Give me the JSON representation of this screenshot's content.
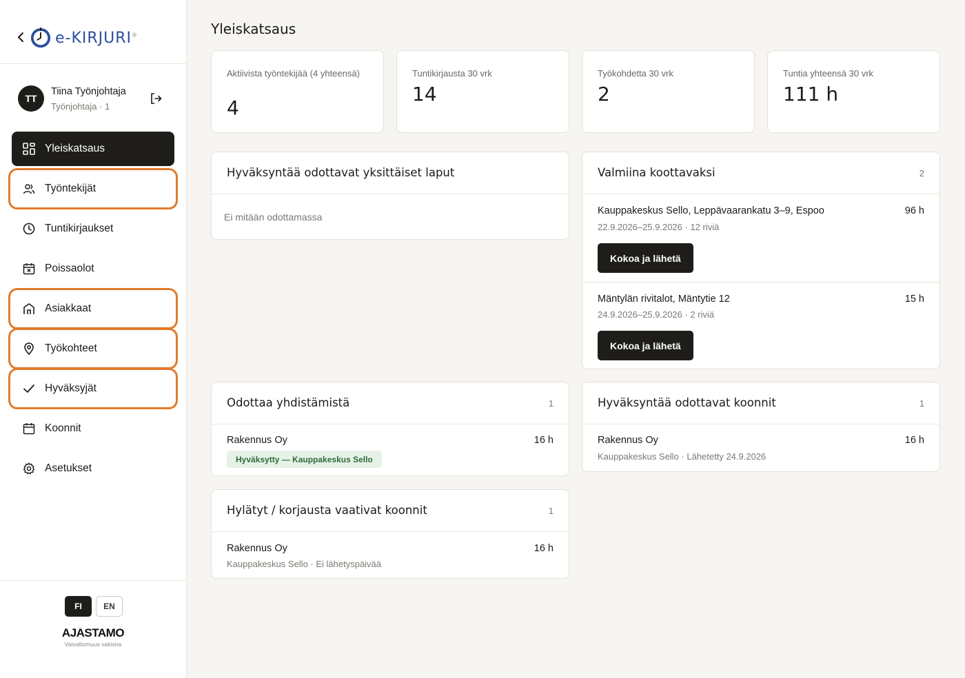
{
  "brand": {
    "logo_text": "e-KIRJURI",
    "logo_mark": "®"
  },
  "user": {
    "initials": "TT",
    "name": "Tiina Työnjohtaja",
    "role": "Työnjohtaja · 1"
  },
  "nav": [
    {
      "label": "Yleiskatsaus",
      "icon": "grid-icon"
    },
    {
      "label": "Työntekijät",
      "icon": "users-icon"
    },
    {
      "label": "Tuntikirjaukset",
      "icon": "clock-icon"
    },
    {
      "label": "Poissaolot",
      "icon": "calendar-x-icon"
    },
    {
      "label": "Asiakkaat",
      "icon": "building-icon"
    },
    {
      "label": "Työkohteet",
      "icon": "map-pin-icon"
    },
    {
      "label": "Hyväksyjät",
      "icon": "check-icon"
    },
    {
      "label": "Koonnit",
      "icon": "calendar-icon"
    },
    {
      "label": "Asetukset",
      "icon": "gear-icon"
    }
  ],
  "lang": {
    "fi": "FI",
    "en": "EN"
  },
  "vendor": {
    "name": "AJASTAMO",
    "tagline": "Vaivattomuus vakiona"
  },
  "page": {
    "title": "Yleiskatsaus"
  },
  "stats": [
    {
      "label": "Aktiivista työntekijää (4 yhteensä)",
      "value": "4"
    },
    {
      "label": "Tuntikirjausta 30 vrk",
      "value": "14"
    },
    {
      "label": "Työkohdetta 30 vrk",
      "value": "2"
    },
    {
      "label": "Tuntia yhteensä 30 vrk",
      "value": "111 h"
    }
  ],
  "pending_sheets": {
    "title": "Hyväksyntää odottavat yksittäiset laput",
    "empty": "Ei mitään odottamassa"
  },
  "ready": {
    "title": "Valmiina koottavaksi",
    "count": "2",
    "items": [
      {
        "name": "Kauppakeskus Sello, Leppävaarankatu 3–9, Espoo",
        "hours": "96 h",
        "meta": "22.9.2026–25.9.2026 · 12 riviä",
        "button": "Kokoa ja lähetä"
      },
      {
        "name": "Mäntylän rivitalot, Mäntytie 12",
        "hours": "15 h",
        "meta": "24.9.2026–25.9.2026 · 2 riviä",
        "button": "Kokoa ja lähetä"
      }
    ]
  },
  "merge": {
    "title": "Odottaa yhdistämistä",
    "count": "1",
    "items": [
      {
        "name": "Rakennus Oy",
        "hours": "16 h",
        "badge": "Hyväksytty — Kauppakeskus Sello"
      }
    ]
  },
  "approval": {
    "title": "Hyväksyntää odottavat koonnit",
    "count": "1",
    "items": [
      {
        "name": "Rakennus Oy",
        "hours": "16 h",
        "meta": "Kauppakeskus Sello · Lähetetty 24.9.2026"
      }
    ]
  },
  "rejected": {
    "title": "Hylätyt / korjausta vaativat koonnit",
    "count": "1",
    "items": [
      {
        "name": "Rakennus Oy",
        "hours": "16 h",
        "meta": "Kauppakeskus Sello · Ei lähetyspäivää"
      }
    ]
  }
}
